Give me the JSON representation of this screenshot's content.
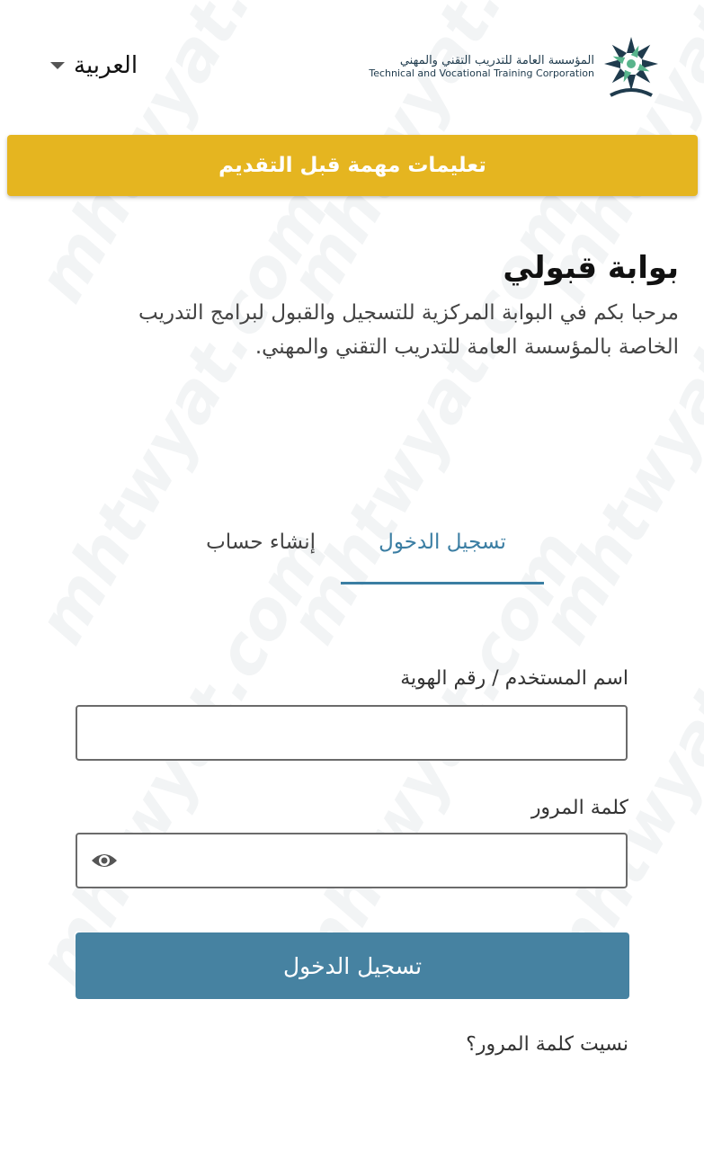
{
  "header": {
    "language_label": "العربية",
    "org_name_ar": "المؤسسة العامة للتدريب التقني والمهني",
    "org_name_en": "Technical and Vocational Training Corporation"
  },
  "banner": {
    "label": "تعليمات مهمة قبل التقديم"
  },
  "intro": {
    "title": "بوابة قبولي",
    "welcome": "مرحبا بكم في البوابة المركزية للتسجيل والقبول لبرامج التدريب الخاصة بالمؤسسة العامة للتدريب التقني والمهني."
  },
  "tabs": [
    {
      "label": "تسجيل الدخول",
      "active": true
    },
    {
      "label": "إنشاء حساب",
      "active": false
    }
  ],
  "form": {
    "username_label": "اسم المستخدم / رقم الهوية",
    "username_value": "",
    "password_label": "كلمة المرور",
    "password_value": "",
    "submit_label": "تسجيل الدخول",
    "forgot_label": "نسيت كلمة المرور؟"
  },
  "watermark": {
    "text": "mhtwyat.com"
  },
  "colors": {
    "banner": "#e5b520",
    "accent": "#3b7ea3",
    "button": "#4682a1"
  },
  "icons": {
    "logo": "tvtc-star-logo",
    "language_toggle": "caret-down-icon",
    "password_toggle": "eye-icon"
  }
}
